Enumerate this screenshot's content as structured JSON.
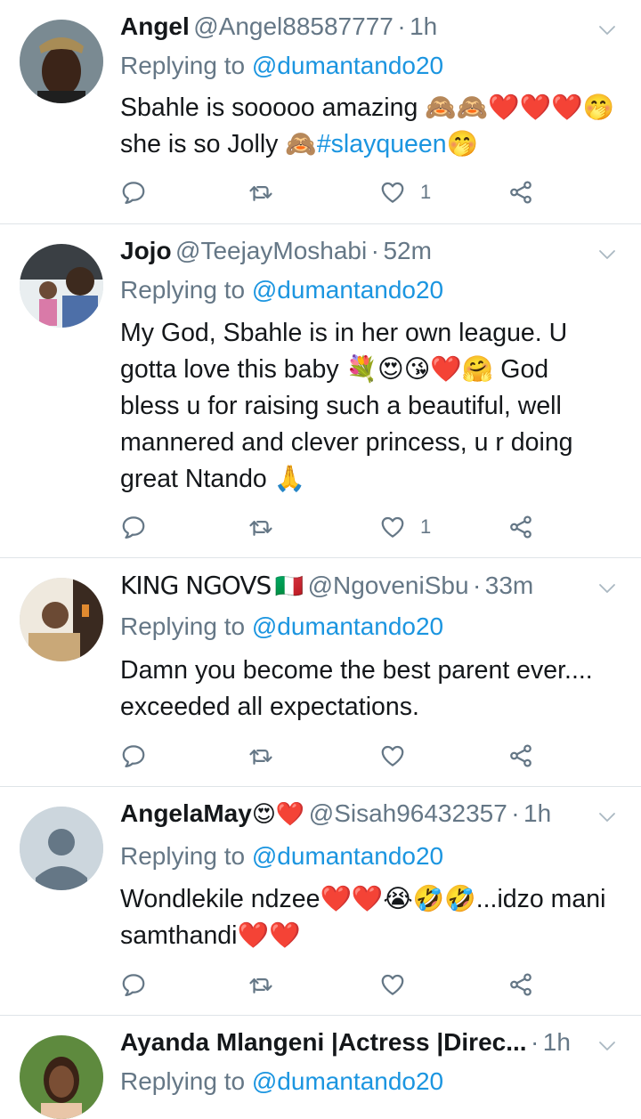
{
  "tweets": [
    {
      "name": "Angel",
      "handle": "@Angel88587777",
      "sep": "·",
      "time": "1h",
      "reply_prefix": "Replying to",
      "reply_to": "@dumantando20",
      "body_line1": "Sbahle is sooooo amazing 🙈🙈❤️❤️❤️🤭",
      "body_line2a": "she is so Jolly 🙈",
      "body_tag": "#slayqueen",
      "body_line2b": "🤭",
      "like_count": "1"
    },
    {
      "name": "Jojo",
      "handle": "@TeejayMoshabi",
      "sep": "·",
      "time": "52m",
      "reply_prefix": "Replying to",
      "reply_to": "@dumantando20",
      "body_line1": "My God, Sbahle is in her own league. U",
      "body_line2": "gotta love this baby 💐😍😘❤️🤗 God",
      "body_line3": "bless u for raising such a beautiful, well",
      "body_line4": "mannered and clever princess, u r doing",
      "body_line5": "great Ntando 🙏",
      "like_count": "1"
    },
    {
      "name": "KING NGOVS",
      "flag": "🇮🇹",
      "handle": "@NgoveniSbu",
      "sep": "·",
      "time": "33m",
      "reply_prefix": "Replying to",
      "reply_to": "@dumantando20",
      "body_line1": "Damn you become the best parent ever....",
      "body_line2": "exceeded all expectations.",
      "like_count": ""
    },
    {
      "name": "AngelaMay",
      "name_emoji": "😍❤️",
      "handle": "@Sisah96432357",
      "sep": "·",
      "time": "1h",
      "reply_prefix": "Replying to",
      "reply_to": "@dumantando20",
      "body_line1": "Wondlekile ndzee❤️❤️😭🤣🤣...idzo mani",
      "body_line2": "samthandi❤️❤️",
      "like_count": ""
    },
    {
      "name": "Ayanda Mlangeni |Actress |Direc...",
      "sep": "·",
      "time": "1h",
      "reply_prefix": "Replying to",
      "reply_to": "@dumantando20"
    }
  ],
  "icons": {
    "reply": "reply-icon",
    "retweet": "retweet-icon",
    "like": "heart-icon",
    "share": "share-icon",
    "more": "chevron-down-icon"
  },
  "colors": {
    "link": "#1b95e0",
    "secondary_text": "#657786",
    "divider": "#dfe4e8"
  }
}
